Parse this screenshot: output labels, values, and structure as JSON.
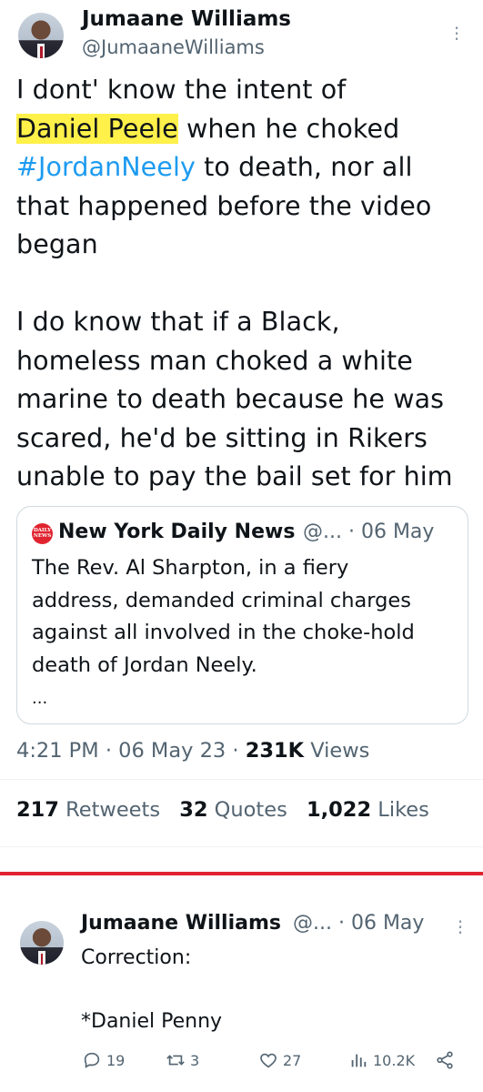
{
  "main_tweet": {
    "author_name": "Jumaane Williams",
    "author_handle": "@JumaaneWilliams",
    "text_lines_1": [
      "I dont' know the intent of",
      "when he choked",
      "to death, nor all",
      "that happened before the video",
      "began"
    ],
    "highlight_name": "Daniel Peele",
    "hashtag": "#JordanNeely",
    "text_lines_2": [
      "I do know that if a Black,",
      "homeless man choked a white",
      "marine to death because he was",
      "scared, he'd be sitting in Rikers",
      "unable to pay the bail set for him"
    ],
    "time": "4:21 PM",
    "date": "06 May 23",
    "views_count": "231K",
    "views_label": "Views",
    "retweets_count": "217",
    "retweets_label": "Retweets",
    "quotes_count": "32",
    "quotes_label": "Quotes",
    "likes_count": "1,022",
    "likes_label": "Likes"
  },
  "quoted_tweet": {
    "logo_text": "DAILY NEWS",
    "author_name": "New York Daily News",
    "meta": "@... · 06 May",
    "lines": [
      "The Rev. Al Sharpton, in a fiery",
      "address, demanded criminal charges",
      "against all involved in the choke-hold",
      "death of Jordan Neely."
    ],
    "ellipsis": "..."
  },
  "reply_tweet": {
    "author_name": "Jumaane Williams",
    "meta": "@... · 06 May",
    "line1": "Correction:",
    "line2": "*Daniel Penny",
    "replies": "19",
    "retweets": "3",
    "likes": "27",
    "views": "10.2K"
  },
  "colors": {
    "accent": "#1d9bf0",
    "highlight": "#fff04a",
    "separator_red": "#e0242f",
    "muted": "#536471"
  }
}
